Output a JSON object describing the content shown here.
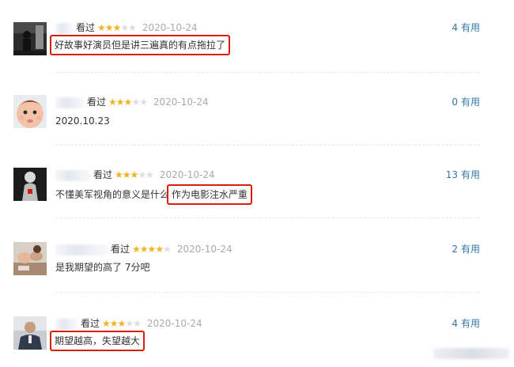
{
  "star_colors": {
    "on": "#f4b223",
    "off": "#dddddd"
  },
  "highlight_color": "#d81e06",
  "link_color": "#3377aa",
  "reviews": [
    {
      "avatar": "dark-silhouette-avatar",
      "status": "看过",
      "rating": 3,
      "date": "2020-10-24",
      "votes": "4",
      "votes_label": "有用",
      "comment": "好故事好演员但是讲三遍真的有点拖拉了",
      "comment_plain": "",
      "comment_highlight": "好故事好演员但是讲三遍真的有点拖拉了"
    },
    {
      "avatar": "baby-face-avatar",
      "status": "看过",
      "rating": 3,
      "date": "2020-10-24",
      "votes": "0",
      "votes_label": "有用",
      "comment_plain": "2020.10.23",
      "comment_highlight": ""
    },
    {
      "avatar": "figure-red-accent-avatar",
      "status": "看过",
      "rating": 3,
      "date": "2020-10-24",
      "votes": "13",
      "votes_label": "有用",
      "comment_plain": "不懂美军视角的意义是什么",
      "comment_highlight": "作为电影注水严重"
    },
    {
      "avatar": "hands-photo-avatar",
      "status": "看过",
      "rating": 4,
      "date": "2020-10-24",
      "votes": "2",
      "votes_label": "有用",
      "comment_plain": "是我期望的高了 7分吧",
      "comment_highlight": ""
    },
    {
      "avatar": "person-portrait-avatar",
      "status": "看过",
      "rating": 3,
      "date": "2020-10-24",
      "votes": "4",
      "votes_label": "有用",
      "comment_plain": "",
      "comment_highlight": "期望越高，失望越大"
    }
  ]
}
